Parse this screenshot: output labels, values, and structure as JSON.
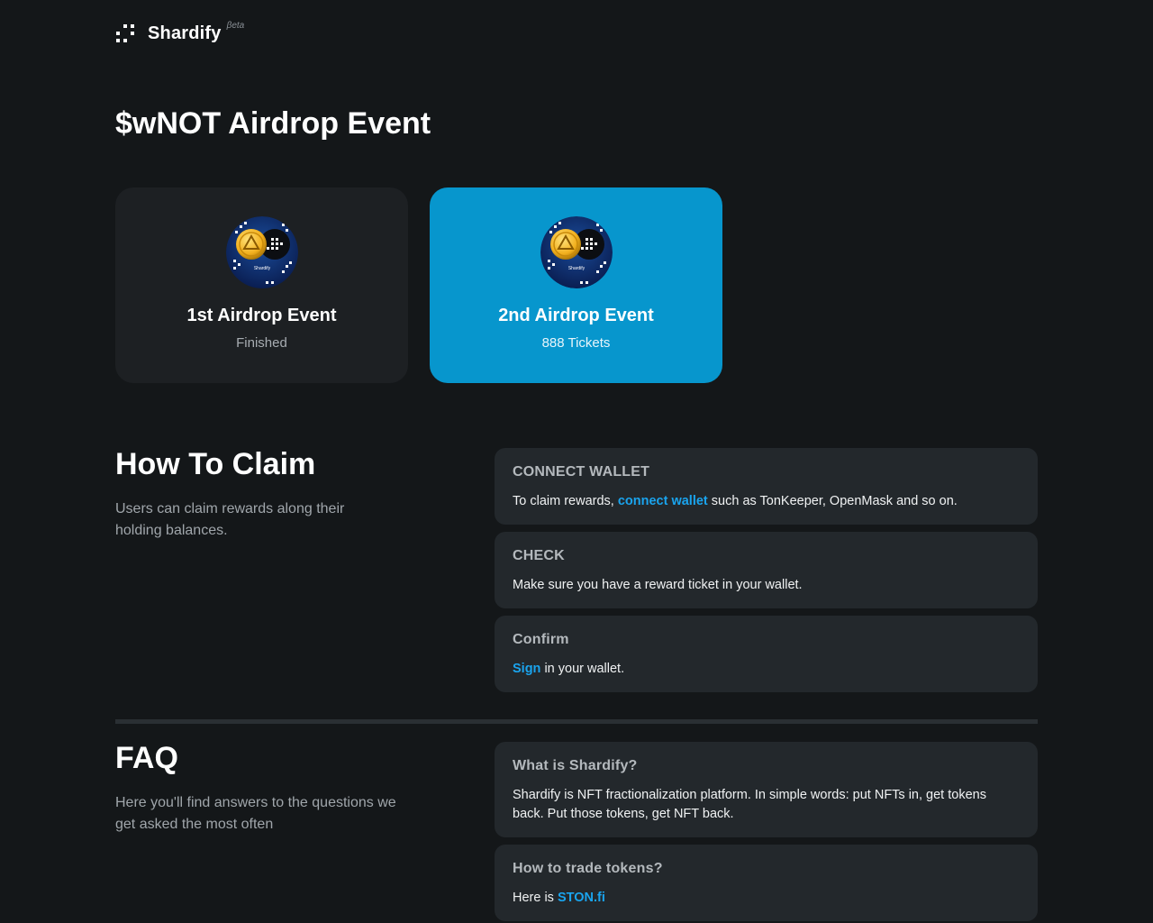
{
  "header": {
    "brand": "Shardify",
    "beta": "βeta"
  },
  "page": {
    "title": "$wNOT Airdrop Event"
  },
  "events": [
    {
      "name": "1st Airdrop Event",
      "status": "Finished"
    },
    {
      "name": "2nd Airdrop Event",
      "status": "888 Tickets"
    }
  ],
  "event_avatar_label": "Shardify",
  "how_to_claim": {
    "title": "How To Claim",
    "description": "Users can claim rewards along their holding balances.",
    "steps": [
      {
        "title": "CONNECT WALLET",
        "text_before": "To claim rewards, ",
        "link": "connect wallet",
        "text_after": " such as TonKeeper, OpenMask and so on."
      },
      {
        "title": "CHECK",
        "text": "Make sure you have a reward ticket in your wallet."
      },
      {
        "title": "Confirm",
        "link": "Sign",
        "text_after": " in your wallet."
      }
    ]
  },
  "faq": {
    "title": "FAQ",
    "description": "Here you'll find answers to the questions we get asked the most often",
    "items": [
      {
        "question": "What is Shardify?",
        "answer": "Shardify is NFT fractionalization platform. In simple words: put NFTs in, get tokens back. Put those tokens, get NFT back."
      },
      {
        "question": "How to trade tokens?",
        "answer_before": "Here is ",
        "link": "STON.fi"
      }
    ]
  },
  "colors": {
    "background": "#141719",
    "card": "#1d2023",
    "active_card": "#0796cd",
    "step_card": "#23282c",
    "link": "#1aa4ee"
  }
}
